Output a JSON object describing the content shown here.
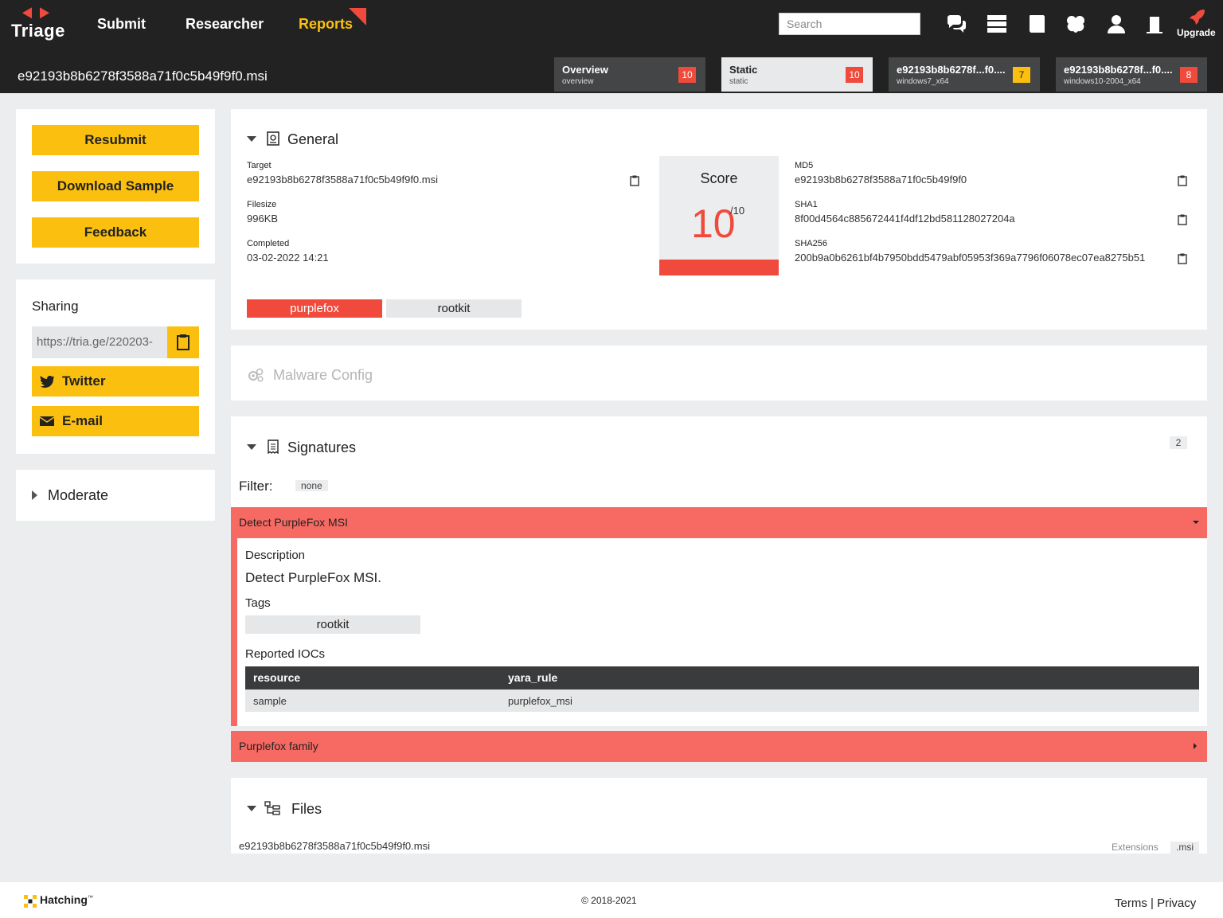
{
  "app": {
    "logo_text": "Triage",
    "nav": [
      "Submit",
      "Researcher",
      "Reports"
    ],
    "search_placeholder": "Search",
    "upgrade_label": "Upgrade"
  },
  "header": {
    "filename": "e92193b8b6278f3588a71f0c5b49f9f0.msi",
    "tabs": [
      {
        "title": "Overview",
        "sub": "overview",
        "score": "10",
        "color": "#f04a3c"
      },
      {
        "title": "Static",
        "sub": "static",
        "score": "10",
        "color": "#f04a3c"
      },
      {
        "title": "e92193b8b6278f...f0....",
        "sub": "windows7_x64",
        "score": "7",
        "color": "#fbc00f"
      },
      {
        "title": "e92193b8b6278f...f0....",
        "sub": "windows10-2004_x64",
        "score": "8",
        "color": "#f04a3c"
      }
    ]
  },
  "sidebar": {
    "resubmit": "Resubmit",
    "download": "Download Sample",
    "feedback": "Feedback",
    "sharing_title": "Sharing",
    "share_url": "https://tria.ge/220203-",
    "twitter": "Twitter",
    "email": "E-mail",
    "moderate": "Moderate"
  },
  "general": {
    "title": "General",
    "target_label": "Target",
    "target_value": "e92193b8b6278f3588a71f0c5b49f9f0.msi",
    "filesize_label": "Filesize",
    "filesize_value": "996KB",
    "completed_label": "Completed",
    "completed_value": "03-02-2022 14:21",
    "score_label": "Score",
    "score_value": "10",
    "score_max": "/10",
    "md5_label": "MD5",
    "md5_value": "e92193b8b6278f3588a71f0c5b49f9f0",
    "sha1_label": "SHA1",
    "sha1_value": "8f00d4564c885672441f4df12bd581128027204a",
    "sha256_label": "SHA256",
    "sha256_value": "200b9a0b6261bf4b7950bdd5479abf05953f369a7796f06078ec07ea8275b51",
    "tags": [
      "purplefox",
      "rootkit"
    ]
  },
  "malware_config": {
    "title": "Malware Config"
  },
  "signatures": {
    "title": "Signatures",
    "count": "2",
    "filter_label": "Filter:",
    "filter_value": "none",
    "items": [
      {
        "name": "Detect PurpleFox MSI"
      },
      {
        "name": "Purplefox family"
      }
    ],
    "expanded": {
      "description_label": "Description",
      "description": "Detect PurpleFox MSI.",
      "tags_label": "Tags",
      "tag": "rootkit",
      "iocs_label": "Reported IOCs",
      "columns": [
        "resource",
        "yara_rule"
      ],
      "rows": [
        [
          "sample",
          "purplefox_msi"
        ]
      ]
    }
  },
  "files": {
    "title": "Files",
    "file_name": "e92193b8b6278f3588a71f0c5b49f9f0.msi",
    "extensions_label": "Extensions",
    "extension": ".msi"
  },
  "footer": {
    "brand": "Hatching",
    "tm": "™",
    "copyright": "© 2018-2021",
    "terms": "Terms",
    "separator": "|",
    "privacy": "Privacy"
  }
}
